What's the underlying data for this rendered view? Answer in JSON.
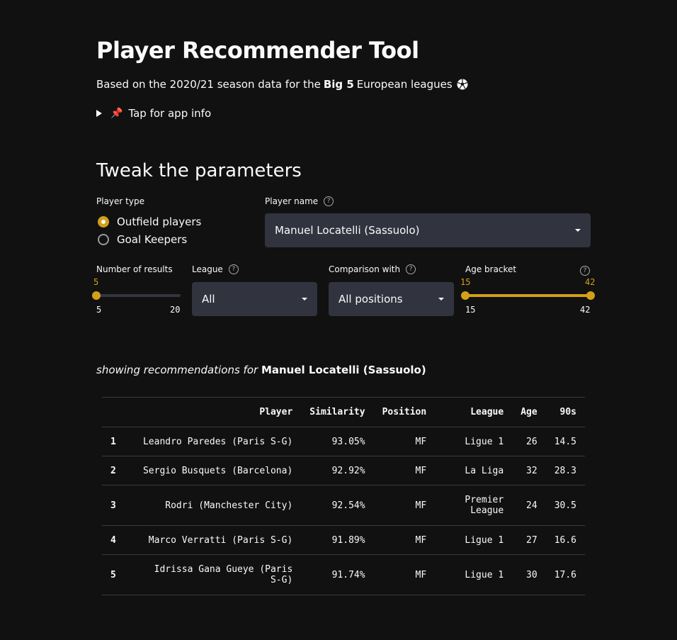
{
  "header": {
    "title": "Player Recommender Tool",
    "subtitle_pre": "Based on the 2020/21 season data for the",
    "subtitle_bold": "Big 5",
    "subtitle_post": "European leagues",
    "subtitle_icon": "soccer-ball-icon",
    "expander_label": "Tap for app info",
    "expander_icon": "pushpin-icon"
  },
  "params": {
    "heading": "Tweak the parameters",
    "player_type": {
      "label": "Player type",
      "options": [
        "Outfield players",
        "Goal Keepers"
      ],
      "selected": 0
    },
    "player_name": {
      "label": "Player name",
      "value": "Manuel Locatelli (Sassuolo)"
    },
    "num_results": {
      "label": "Number of results",
      "value": "5",
      "min": "5",
      "max": "20"
    },
    "league": {
      "label": "League",
      "value": "All"
    },
    "comparison": {
      "label": "Comparison with",
      "value": "All positions"
    },
    "age": {
      "label": "Age bracket",
      "low": "15",
      "high": "42",
      "min": "15",
      "max": "42"
    }
  },
  "results": {
    "note_pre": "showing recommendations for",
    "note_player": "Manuel Locatelli (Sassuolo)",
    "columns": [
      "",
      "Player",
      "Similarity",
      "Position",
      "League",
      "Age",
      "90s"
    ],
    "rows": [
      [
        "1",
        "Leandro Paredes (Paris S-G)",
        "93.05%",
        "MF",
        "Ligue 1",
        "26",
        "14.5"
      ],
      [
        "2",
        "Sergio Busquets (Barcelona)",
        "92.92%",
        "MF",
        "La Liga",
        "32",
        "28.3"
      ],
      [
        "3",
        "Rodri (Manchester City)",
        "92.54%",
        "MF",
        "Premier League",
        "24",
        "30.5"
      ],
      [
        "4",
        "Marco Verratti (Paris S-G)",
        "91.89%",
        "MF",
        "Ligue 1",
        "27",
        "16.6"
      ],
      [
        "5",
        "Idrissa Gana Gueye (Paris S-G)",
        "91.74%",
        "MF",
        "Ligue 1",
        "30",
        "17.6"
      ]
    ]
  },
  "colors": {
    "accent": "#d4a017",
    "background": "#111111",
    "input_bg": "#31333f"
  }
}
